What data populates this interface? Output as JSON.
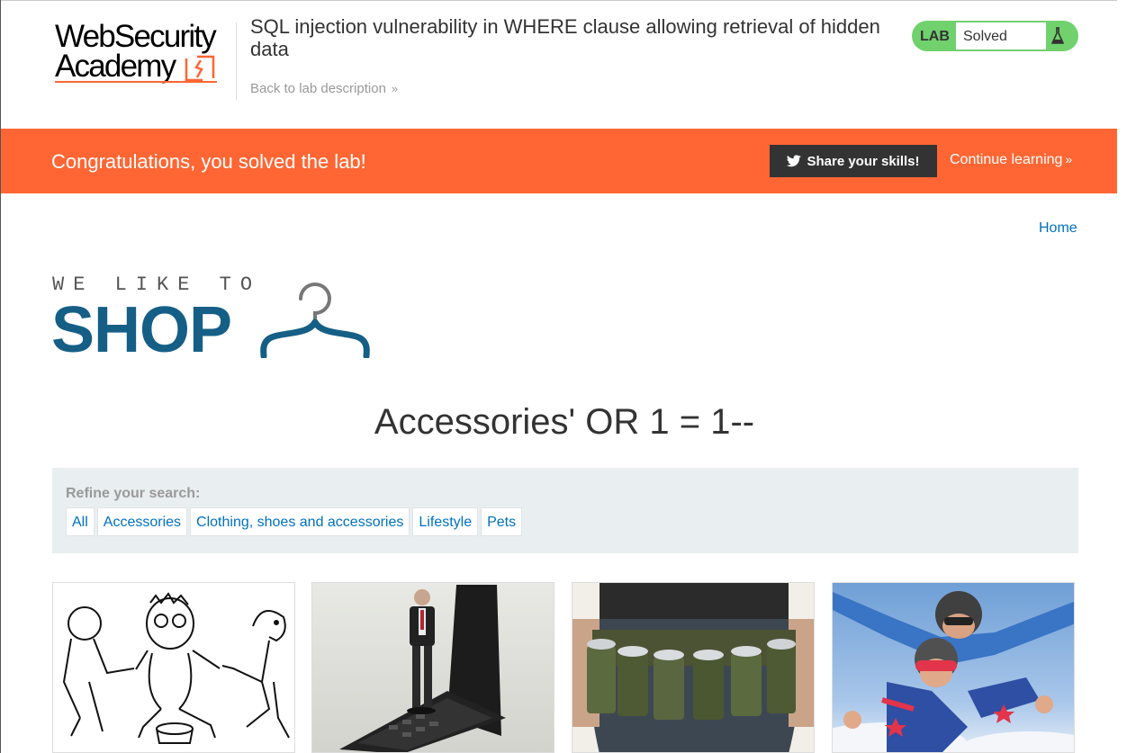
{
  "header": {
    "logo_line1": "WebSecurity",
    "logo_line2": "Academy",
    "lab_title": "SQL injection vulnerability in WHERE clause allowing retrieval of hidden data",
    "back_link": "Back to lab description",
    "status_label": "LAB",
    "status_value": "Solved"
  },
  "banner": {
    "message": "Congratulations, you solved the lab!",
    "share_button": "Share your skills!",
    "continue_link": "Continue learning"
  },
  "nav": {
    "home": "Home"
  },
  "shop_logo": {
    "tagline": "WE LIKE TO",
    "word": "SHOP"
  },
  "page": {
    "heading": "Accessories' OR 1 = 1--"
  },
  "filters": {
    "label": "Refine your search:",
    "options": [
      "All",
      "Accessories",
      "Clothing, shoes and accessories",
      "Lifestyle",
      "Pets"
    ]
  },
  "products": [
    {
      "image": "cartoon-tug-of-war"
    },
    {
      "image": "figurine-on-flip-phone"
    },
    {
      "image": "beer-can-belt"
    },
    {
      "image": "tandem-skydivers"
    }
  ],
  "colors": {
    "accent_orange": "#ff6633",
    "solved_green": "#70d16d",
    "link_blue": "#0071bc",
    "shop_blue": "#155f86"
  }
}
